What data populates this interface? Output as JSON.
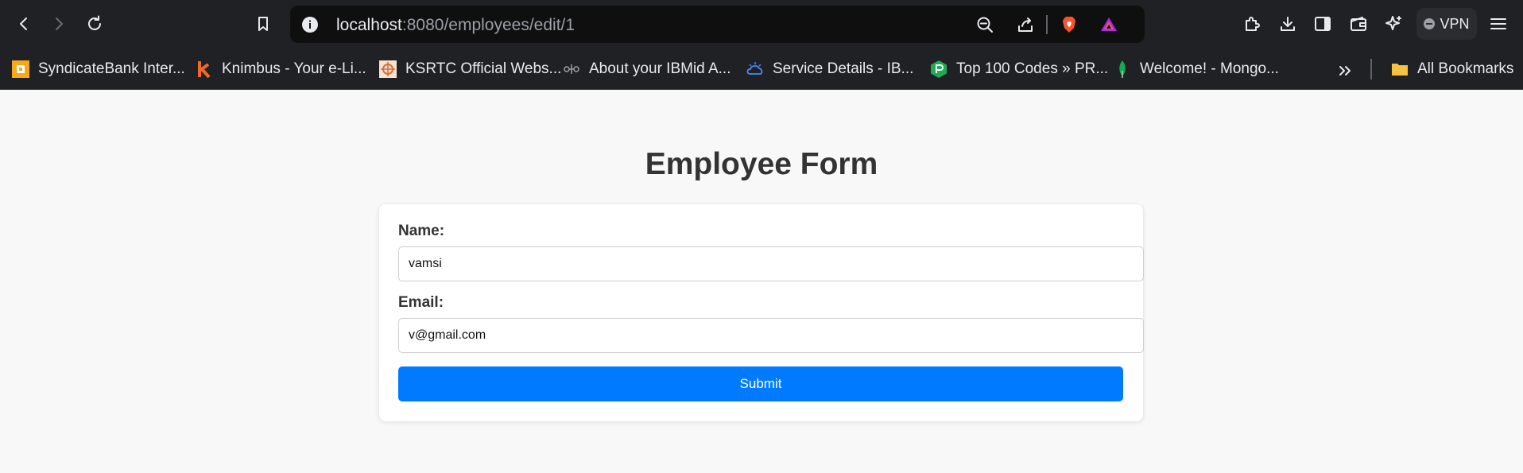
{
  "browser": {
    "url_host": "localhost",
    "url_path": ":8080/employees/edit/1",
    "vpn_label": "VPN"
  },
  "bookmarks": [
    {
      "label": "SyndicateBank Inter...",
      "icon": "syndicatebank-icon"
    },
    {
      "label": "Knimbus - Your e-Li...",
      "icon": "knimbus-icon"
    },
    {
      "label": "KSRTC Official Webs...",
      "icon": "ksrtc-icon"
    },
    {
      "label": "About your IBMid A...",
      "icon": "ibm-icon"
    },
    {
      "label": "Service Details - IB...",
      "icon": "ibm-cloud-icon"
    },
    {
      "label": "Top 100 Codes » PR...",
      "icon": "prepinsta-icon"
    },
    {
      "label": "Welcome! - Mongo...",
      "icon": "mongodb-icon"
    }
  ],
  "all_bookmarks_label": "All Bookmarks",
  "form": {
    "title": "Employee Form",
    "name_label": "Name:",
    "name_value": "vamsi",
    "email_label": "Email:",
    "email_value": "v@gmail.com",
    "submit_label": "Submit"
  },
  "colors": {
    "chrome_bg": "#202124",
    "page_bg": "#f8f8f8",
    "submit_bg": "#007bff",
    "title_text": "#333333"
  }
}
